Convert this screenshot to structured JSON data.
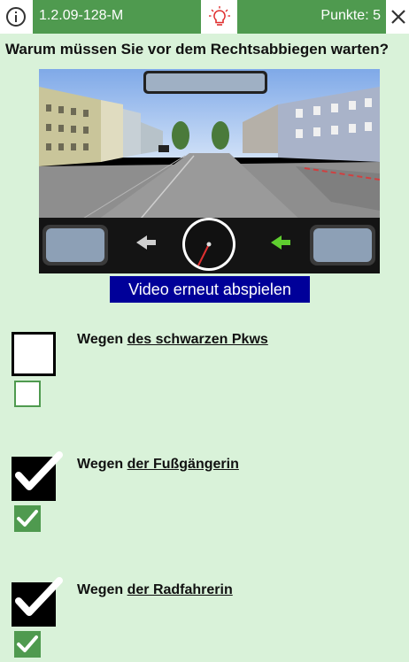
{
  "toolbar": {
    "question_id": "1.2.09-128-M",
    "score_label": "Punkte: 5",
    "info_icon": "info-icon",
    "hint_icon": "lightbulb-icon",
    "close_icon": "close-icon",
    "accent_color": "#4f9a4f"
  },
  "question": {
    "text": "Warum müssen Sie vor dem Rechtsabbiegen warten?"
  },
  "video": {
    "replay_label": "Video erneut abspielen",
    "replay_color": "#000099"
  },
  "answers": [
    {
      "prefix": "Wegen ",
      "emphasis": "des schwarzen Pkws",
      "selected": false,
      "correct": false
    },
    {
      "prefix": "Wegen ",
      "emphasis": "der Fußgängerin",
      "selected": true,
      "correct": true
    },
    {
      "prefix": "Wegen ",
      "emphasis": "der Radfahrerin",
      "selected": true,
      "correct": true
    }
  ]
}
